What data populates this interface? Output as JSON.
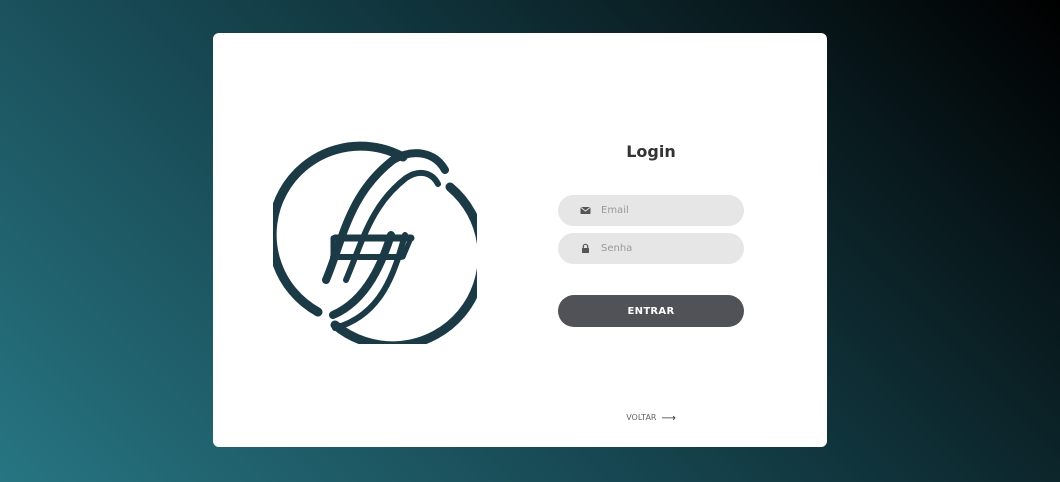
{
  "login": {
    "title": "Login",
    "email_placeholder": "Email",
    "password_placeholder": "Senha",
    "submit_label": "ENTRAR",
    "back_label": "VOLTAR",
    "back_arrow": "⟶"
  },
  "icons": {
    "email": "envelope-icon",
    "password": "lock-icon",
    "back": "arrow-right-icon"
  },
  "colors": {
    "background_start": "#277582",
    "background_end": "#000000",
    "card": "#ffffff",
    "logo": "#1b3a45",
    "input_bg": "#e6e6e6",
    "button_bg": "#505257",
    "button_text": "#ffffff",
    "title_text": "#333333"
  }
}
